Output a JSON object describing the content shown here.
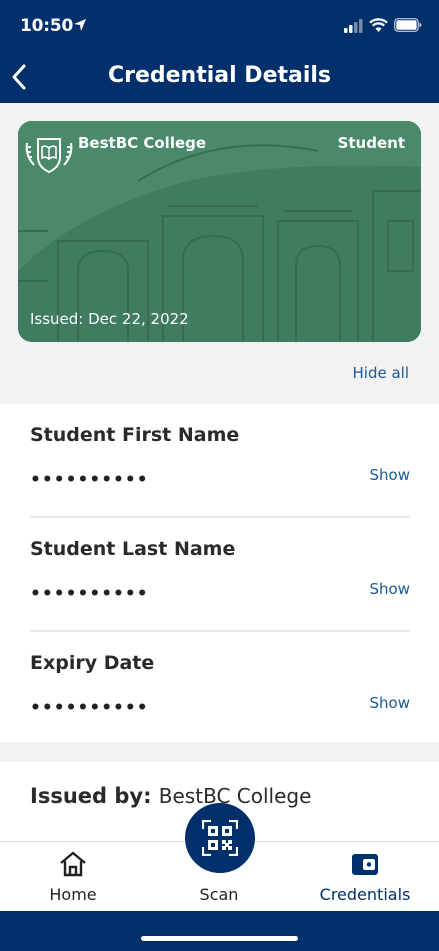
{
  "status": {
    "time": "10:50"
  },
  "header": {
    "title": "Credential Details"
  },
  "card": {
    "organization": "BestBC College",
    "type": "Student",
    "issued": "Issued: Dec 22, 2022",
    "color": "#3d7a5d"
  },
  "hide_all_label": "Hide all",
  "attributes": [
    {
      "label": "Student First Name",
      "value": "••••••••••",
      "action": "Show"
    },
    {
      "label": "Student Last Name",
      "value": "••••••••••",
      "action": "Show"
    },
    {
      "label": "Expiry Date",
      "value": "••••••••••",
      "action": "Show"
    }
  ],
  "issued_by": {
    "label": "Issued by:",
    "value": "BestBC College"
  },
  "nav": {
    "items": [
      {
        "label": "Home",
        "icon": "home-icon"
      },
      {
        "label": "Scan",
        "icon": "qr-code-icon"
      },
      {
        "label": "Credentials",
        "icon": "wallet-icon"
      }
    ],
    "active": "Credentials"
  },
  "colors": {
    "primary": "#00306b",
    "link": "#1a5a96"
  }
}
